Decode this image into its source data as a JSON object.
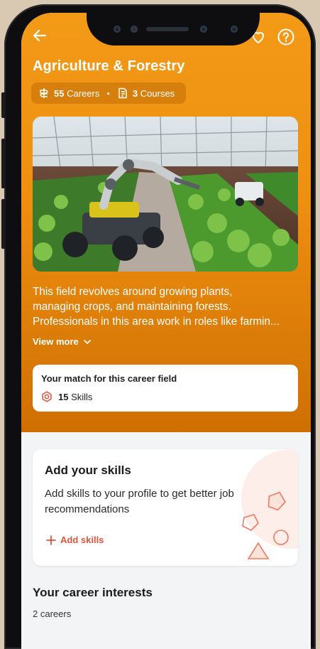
{
  "header": {
    "title": "Agriculture & Forestry",
    "careers_count": "55",
    "careers_label": "Careers",
    "separator": "•",
    "courses_count": "3",
    "courses_label": "Courses"
  },
  "description": {
    "line1": "This field revolves around growing plants,",
    "line2": "managing crops, and maintaining forests.",
    "line3": "Professionals in this area work in roles like farmin...",
    "view_more": "View more"
  },
  "match": {
    "title": "Your match for this career field",
    "skills_count": "15",
    "skills_label": "Skills"
  },
  "add_skills": {
    "title": "Add your skills",
    "body": "Add skills to your profile to get better job recommendations",
    "action": "Add skills"
  },
  "interests": {
    "title": "Your career interests",
    "count_text": "2 careers"
  },
  "icons": {
    "back": "back-arrow-icon",
    "favorite": "heart-icon",
    "help": "help-circle-icon",
    "careers": "signpost-icon",
    "courses": "course-document-icon",
    "skills": "skills-badge-icon",
    "chevron": "chevron-down-icon",
    "plus": "plus-icon"
  },
  "colors": {
    "hero_orange": "#f39a17",
    "accent_red": "#e1533a",
    "background": "#f3f4f6"
  }
}
